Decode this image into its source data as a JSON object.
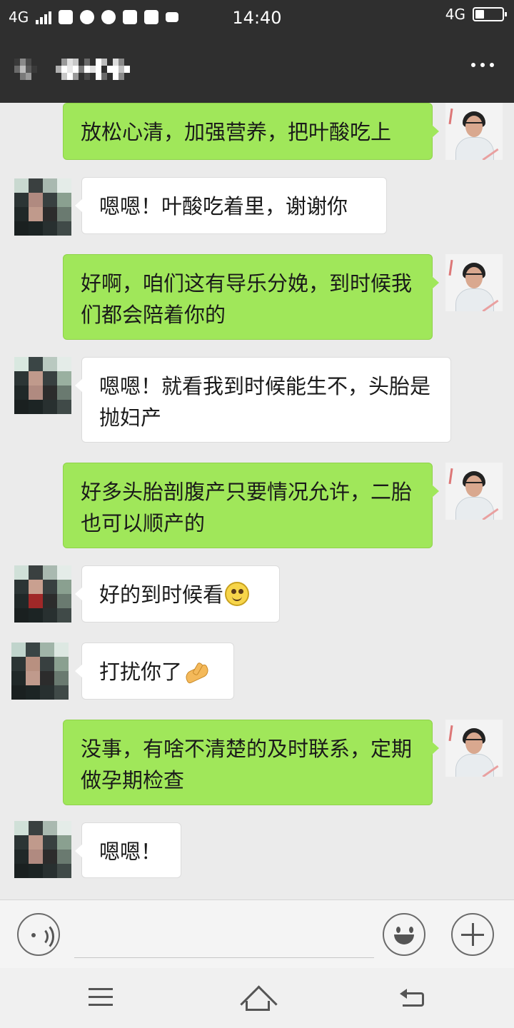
{
  "status_bar": {
    "network": "4G",
    "time": "14:40",
    "network_right": "4G",
    "battery_level": 0.3
  },
  "header": {
    "title": "",
    "more_icon": "more-dots-icon"
  },
  "messages": [
    {
      "side": "me",
      "text": "放松心清，加强营养，把叶酸吃上"
    },
    {
      "side": "them",
      "text": "嗯嗯！叶酸吃着里，谢谢你"
    },
    {
      "side": "me",
      "text": "好啊，咱们这有导乐分娩，到时候我们都会陪着你的"
    },
    {
      "side": "them",
      "text": "嗯嗯！就看我到时候能生不，头胎是抛妇产"
    },
    {
      "side": "me",
      "text": "好多头胎剖腹产只要情况允许，二胎也可以顺产的"
    },
    {
      "side": "them",
      "text": "好的到时候看",
      "emoji": "smile-emoji"
    },
    {
      "side": "them",
      "text": "打扰你了",
      "emoji": "pointing-hand-emoji"
    },
    {
      "side": "me",
      "text": "没事，有啥不清楚的及时联系，定期做孕期检查"
    },
    {
      "side": "them",
      "text": "嗯嗯！"
    }
  ],
  "input_bar": {
    "voice_icon": "voice-icon",
    "placeholder": "",
    "emoji_icon": "emoji-icon",
    "add_icon": "plus-icon"
  },
  "system_nav": {
    "menu_icon": "menu-icon",
    "home_icon": "home-icon",
    "back_icon": "back-icon"
  },
  "colors": {
    "header_bg": "#2f2f2f",
    "chat_bg": "#ebebeb",
    "my_bubble": "#a0e75a",
    "their_bubble": "#ffffff"
  }
}
